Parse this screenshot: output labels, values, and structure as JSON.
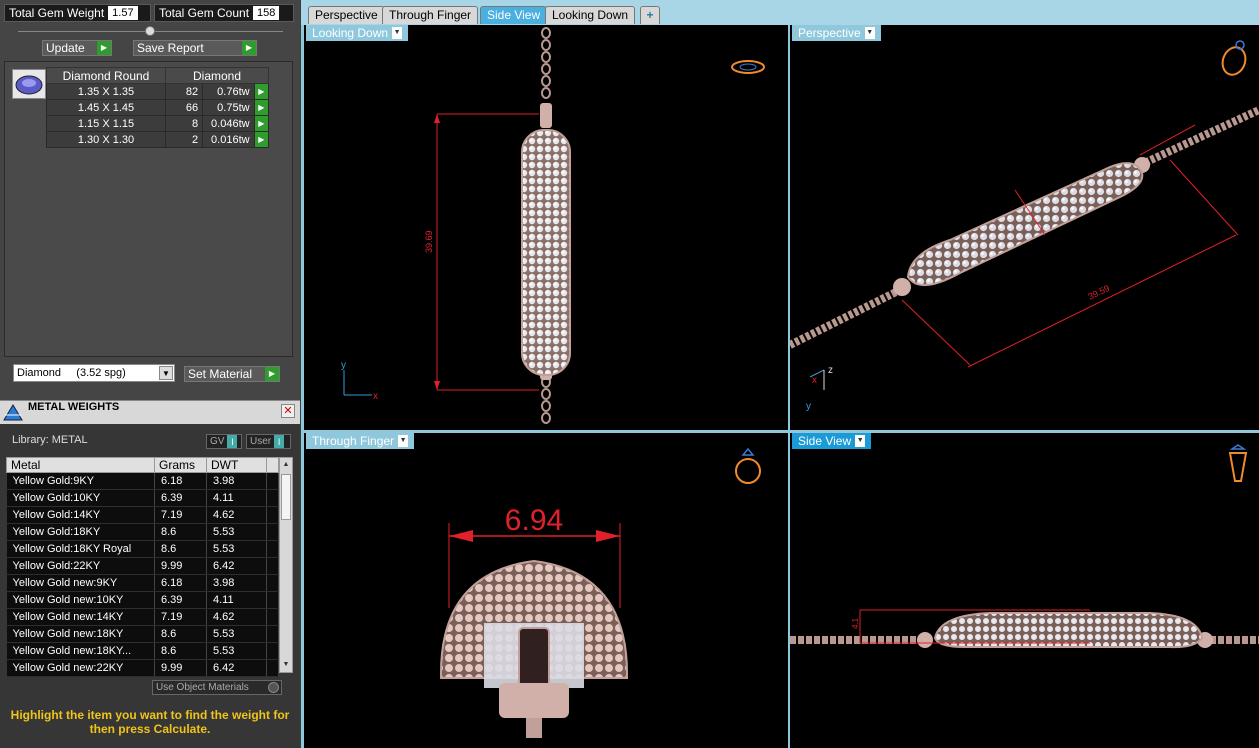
{
  "left_panel": {
    "total_gem_weight_label": "Total Gem Weight",
    "total_gem_weight": "1.57",
    "total_gem_count_label": "Total Gem Count",
    "total_gem_count": "158",
    "update_label": "Update",
    "save_report_label": "Save Report",
    "gem_table": {
      "headers": [
        "Diamond Round",
        "Diamond"
      ],
      "rows": [
        {
          "size": "1.35 X 1.35",
          "count": "82",
          "weight": "0.76tw"
        },
        {
          "size": "1.45 X 1.45",
          "count": "66",
          "weight": "0.75tw"
        },
        {
          "size": "1.15 X 1.15",
          "count": "8",
          "weight": "0.046tw"
        },
        {
          "size": "1.30 X 1.30",
          "count": "2",
          "weight": "0.016tw"
        }
      ]
    },
    "material_select": "Diamond     (3.52 spg)",
    "set_material_label": "Set Material"
  },
  "metal_weights": {
    "title": "METAL WEIGHTS",
    "library_label": "Library: METAL",
    "gv_label": "GV",
    "user_label": "User",
    "headers": [
      "Metal",
      "Grams",
      "DWT"
    ],
    "rows": [
      {
        "metal": "Yellow Gold:9KY",
        "grams": "6.18",
        "dwt": "3.98"
      },
      {
        "metal": "Yellow Gold:10KY",
        "grams": "6.39",
        "dwt": "4.11"
      },
      {
        "metal": "Yellow Gold:14KY",
        "grams": "7.19",
        "dwt": "4.62"
      },
      {
        "metal": "Yellow Gold:18KY",
        "grams": "8.6",
        "dwt": "5.53"
      },
      {
        "metal": "Yellow Gold:18KY Royal",
        "grams": "8.6",
        "dwt": "5.53"
      },
      {
        "metal": "Yellow Gold:22KY",
        "grams": "9.99",
        "dwt": "6.42"
      },
      {
        "metal": "Yellow Gold new:9KY",
        "grams": "6.18",
        "dwt": "3.98"
      },
      {
        "metal": "Yellow Gold new:10KY",
        "grams": "6.39",
        "dwt": "4.11"
      },
      {
        "metal": "Yellow Gold new:14KY",
        "grams": "7.19",
        "dwt": "4.62"
      },
      {
        "metal": "Yellow Gold new:18KY",
        "grams": "8.6",
        "dwt": "5.53"
      },
      {
        "metal": "Yellow Gold new:18KY...",
        "grams": "8.6",
        "dwt": "5.53"
      },
      {
        "metal": "Yellow Gold new:22KY",
        "grams": "9.99",
        "dwt": "6.42"
      }
    ],
    "use_object_materials": "Use Object Materials",
    "hint": "Highlight the item you want to find the weight for then press Calculate."
  },
  "tabs": [
    "Perspective",
    "Through Finger",
    "Side View",
    "Looking Down"
  ],
  "active_tab": "Side View",
  "viewports": {
    "top_left": {
      "label": "Looking Down",
      "dimension": "39.69"
    },
    "top_right": {
      "label": "Perspective",
      "dimension": "39.59"
    },
    "bottom_left": {
      "label": "Through Finger",
      "dimension": "6.94"
    },
    "bottom_right": {
      "label": "Side View",
      "dimension": "4.1"
    }
  },
  "axes": {
    "y": "y",
    "x": "x",
    "z": "z"
  },
  "colors": {
    "accent": "#1a9bd8",
    "dimension": "#e0202a",
    "metal": "#d9b4a8",
    "go_button": "#2e9d2e",
    "hint": "#f0c419"
  }
}
